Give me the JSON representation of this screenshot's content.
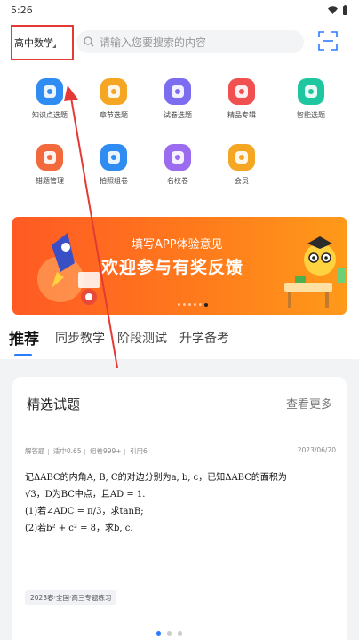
{
  "status_bar": {
    "time": "5:26"
  },
  "top_bar": {
    "subject": "高中数学",
    "search_placeholder": "请输入您要搜索的内容"
  },
  "features": [
    {
      "label": "知识点选题",
      "color": "#2f8cf2",
      "icon": "knowledge-icon"
    },
    {
      "label": "章节选题",
      "color": "#f5a623",
      "icon": "chapter-icon"
    },
    {
      "label": "试卷选题",
      "color": "#7b6cf0",
      "icon": "paper-icon"
    },
    {
      "label": "精品专辑",
      "color": "#f0504f",
      "icon": "album-icon"
    },
    {
      "label": "智能选题",
      "color": "#1fc7a0",
      "icon": "smart-icon"
    },
    {
      "label": "错题管理",
      "color": "#f26a3c",
      "icon": "mistake-icon"
    },
    {
      "label": "拍照组卷",
      "color": "#2f8cf2",
      "icon": "camera-icon"
    },
    {
      "label": "名校卷",
      "color": "#9b6cf0",
      "icon": "school-icon"
    },
    {
      "label": "会员",
      "color": "#f5a623",
      "icon": "member-icon"
    }
  ],
  "banner": {
    "subtitle": "填写APP体验意见",
    "headline": "欢迎参与有奖反馈"
  },
  "tabs": [
    "推荐",
    "同步教学",
    "阶段测试",
    "升学备考"
  ],
  "section": {
    "title": "精选试题",
    "more": "查看更多"
  },
  "question": {
    "type": "解答题",
    "score_rate": "适中0.65",
    "used": "组卷999+",
    "cited": "引用6",
    "date": "2023/06/20",
    "line1": "记ΔABC的内角A, B, C的对边分别为a, b, c，已知ΔABC的面积为",
    "line2": "√3，D为BC中点，且AD = 1.",
    "line3": "(1)若∠ADC = π/3，求tanB;",
    "line4": "(2)若b² + c² = 8，求b, c.",
    "tag": "2023春·全国·高三专题练习"
  },
  "colors": {
    "accent": "#2a7cff",
    "highlight": "#e53935",
    "banner": "#ff6a1f"
  }
}
